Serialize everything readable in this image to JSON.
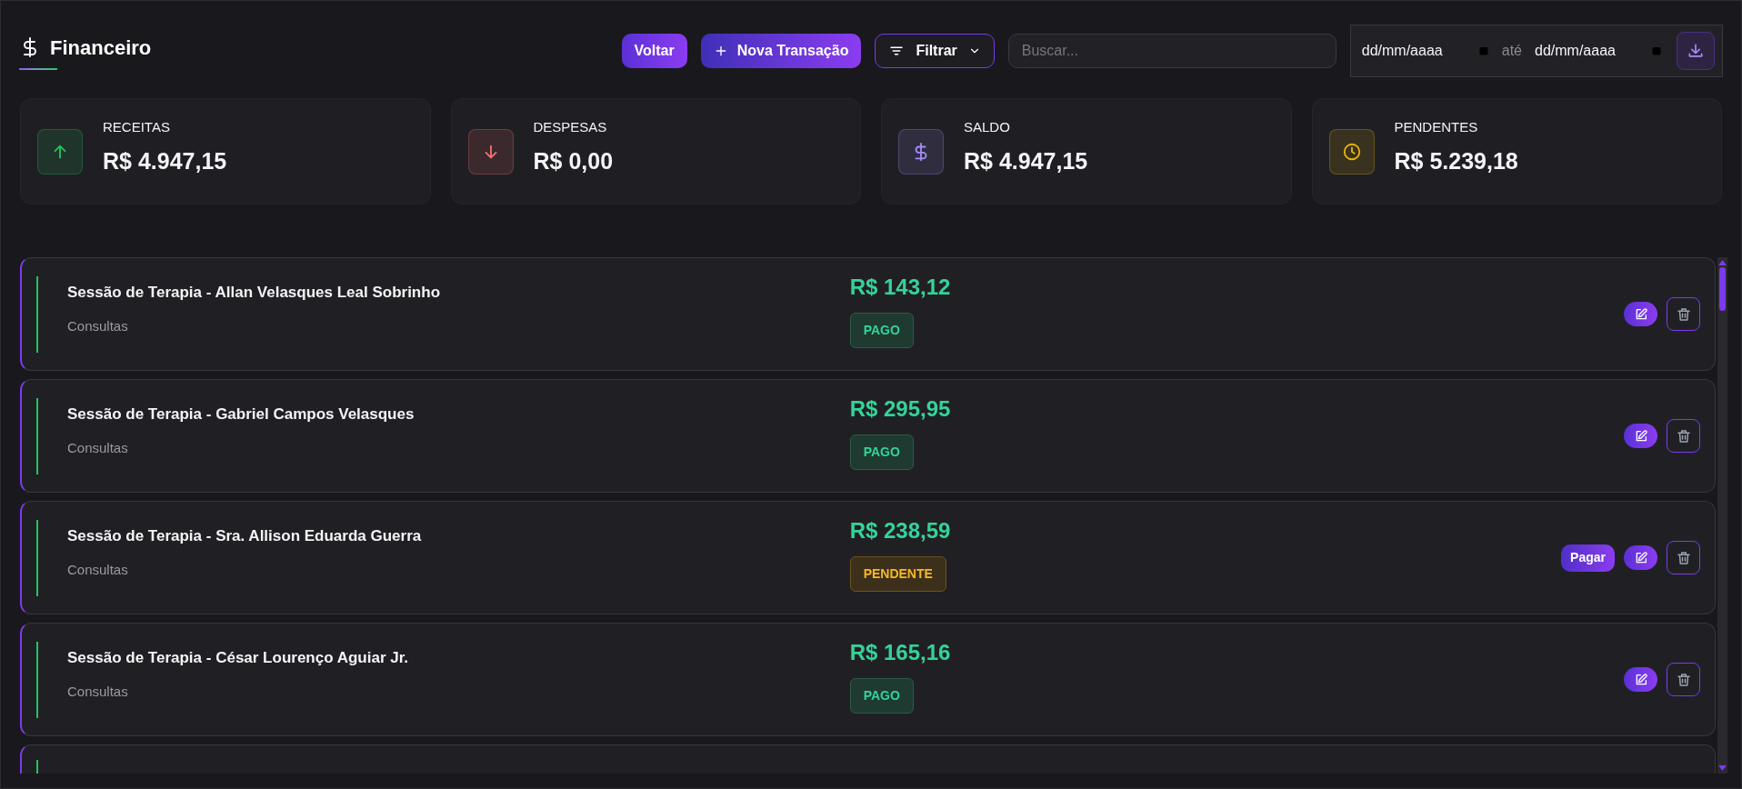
{
  "header": {
    "title": "Financeiro",
    "buttons": [
      {
        "label": "Voltar",
        "kind": "back"
      },
      {
        "label": "Nova Transação",
        "kind": "new"
      }
    ],
    "filter": {
      "label": "Filtrar"
    },
    "search": {
      "placeholder": "Buscar..."
    },
    "date_range": {
      "from_placeholder": "dd/mm/aaaa",
      "separator": "até",
      "to_placeholder": "dd/mm/aaaa"
    }
  },
  "summary_cards": [
    {
      "label": "RECEITAS",
      "value": "R$ 4.947,15",
      "kind": "up",
      "color": "#22c55e"
    },
    {
      "label": "DESPESAS",
      "value": "R$ 0,00",
      "kind": "down",
      "color": "#f87171"
    },
    {
      "label": "SALDO",
      "value": "R$ 4.947,15",
      "kind": "dollar",
      "color": "#a78bfa"
    },
    {
      "label": "PENDENTES",
      "value": "R$ 5.239,18",
      "kind": "clock",
      "color": "#eab308"
    }
  ],
  "transactions": [
    {
      "title": "Sessão de Terapia - Allan Velasques Leal Sobrinho",
      "category": "Consultas",
      "amount": "R$ 143,12",
      "status": {
        "label": "PAGO",
        "kind": "paid"
      }
    },
    {
      "title": "Sessão de Terapia - Gabriel Campos Velasques",
      "category": "Consultas",
      "amount": "R$ 295,95",
      "status": {
        "label": "PAGO",
        "kind": "paid"
      }
    },
    {
      "title": "Sessão de Terapia - Sra. Allison Eduarda Guerra",
      "category": "Consultas",
      "amount": "R$ 238,59",
      "status": {
        "label": "PENDENTE",
        "kind": "pending"
      },
      "pay_label": "Pagar"
    },
    {
      "title": "Sessão de Terapia - César Lourenço Aguiar Jr.",
      "category": "Consultas",
      "amount": "R$ 165,16",
      "status": {
        "label": "PAGO",
        "kind": "paid"
      }
    }
  ]
}
